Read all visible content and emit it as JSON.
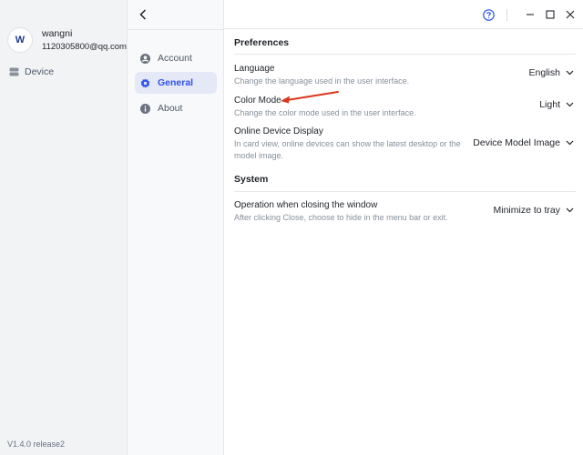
{
  "user": {
    "avatar_letter": "W",
    "name": "wangni",
    "email": "1120305800@qq.com"
  },
  "rail": {
    "device_label": "Device",
    "version": "V1.4.0 release2"
  },
  "nav": {
    "items": [
      {
        "label": "Account",
        "icon": "account-icon",
        "active": false
      },
      {
        "label": "General",
        "icon": "gear-icon",
        "active": true
      },
      {
        "label": "About",
        "icon": "info-icon",
        "active": false
      }
    ]
  },
  "sections": {
    "preferences": {
      "title": "Preferences",
      "settings": [
        {
          "label": "Language",
          "desc": "Change the language used in the user interface.",
          "value": "English"
        },
        {
          "label": "Color Mode",
          "desc": "Change the color mode used in the user interface.",
          "value": "Light"
        },
        {
          "label": "Online Device Display",
          "desc": "In card view, online devices can show the latest desktop or the model image.",
          "value": "Device Model Image"
        }
      ]
    },
    "system": {
      "title": "System",
      "settings": [
        {
          "label": "Operation when closing the window",
          "desc": "After clicking Close, choose to hide in the menu bar or exit.",
          "value": "Minimize to tray"
        }
      ]
    }
  },
  "colors": {
    "accent": "#2f54eb",
    "annotation": "#d9381e"
  }
}
